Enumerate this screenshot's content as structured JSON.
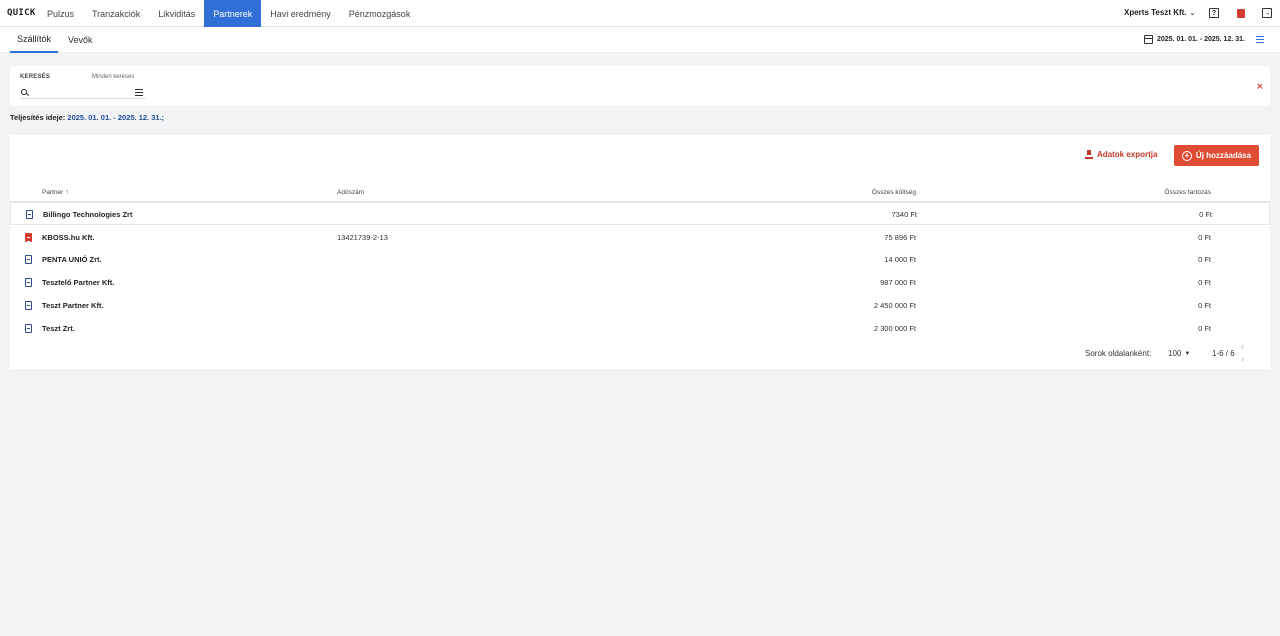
{
  "app": {
    "logo": "QUICK"
  },
  "nav": {
    "items": [
      {
        "label": "Pulzus",
        "active": false
      },
      {
        "label": "Tranzakciók",
        "active": false
      },
      {
        "label": "Likviditás",
        "active": false
      },
      {
        "label": "Partnerek",
        "active": true
      },
      {
        "label": "Havi eredmény",
        "active": false
      },
      {
        "label": "Pénzmozgások",
        "active": false
      }
    ]
  },
  "company": {
    "name": "Xperts Teszt Kft."
  },
  "subnav": {
    "tabs": [
      {
        "label": "Szállítók",
        "active": true
      },
      {
        "label": "Vevők",
        "active": false
      }
    ],
    "date_range": "2025. 01. 01. - 2025. 12. 31."
  },
  "search": {
    "label": "KERESÉS",
    "hint": "Minden kereses",
    "value": ""
  },
  "period": {
    "label": "Teljesítés ideje:",
    "value": "2025. 01. 01. - 2025. 12. 31.;"
  },
  "actions": {
    "export_label": "Adatok exportja",
    "add_label": "Új hozzáadása"
  },
  "table": {
    "columns": {
      "partner": "Partner",
      "tax": "Adószám",
      "cost": "Összes költség",
      "debt": "Összes tartozás"
    },
    "rows": [
      {
        "name": "Billingo Technologies Zrt",
        "tax": "",
        "cost": "7340 Ft",
        "debt": "0 Ft",
        "icon": "doc"
      },
      {
        "name": "KBOSS.hu Kft.",
        "tax": "13421739-2-13",
        "cost": "75 896 Ft",
        "debt": "0 Ft",
        "icon": "doc-red"
      },
      {
        "name": "PENTA UNIÓ Zrt.",
        "tax": "",
        "cost": "14 000 Ft",
        "debt": "0 Ft",
        "icon": "doc"
      },
      {
        "name": "Tesztelő Partner Kft.",
        "tax": "",
        "cost": "987 000 Ft",
        "debt": "0 Ft",
        "icon": "doc"
      },
      {
        "name": "Teszt Partner Kft.",
        "tax": "",
        "cost": "2 450 000 Ft",
        "debt": "0 Ft",
        "icon": "doc"
      },
      {
        "name": "Teszt Zrt.",
        "tax": "",
        "cost": "2 300 000 Ft",
        "debt": "0 Ft",
        "icon": "doc"
      }
    ]
  },
  "pagination": {
    "rows_label": "Sorok oldalanként:",
    "rows_value": "100",
    "range": "1-6 / 6"
  }
}
